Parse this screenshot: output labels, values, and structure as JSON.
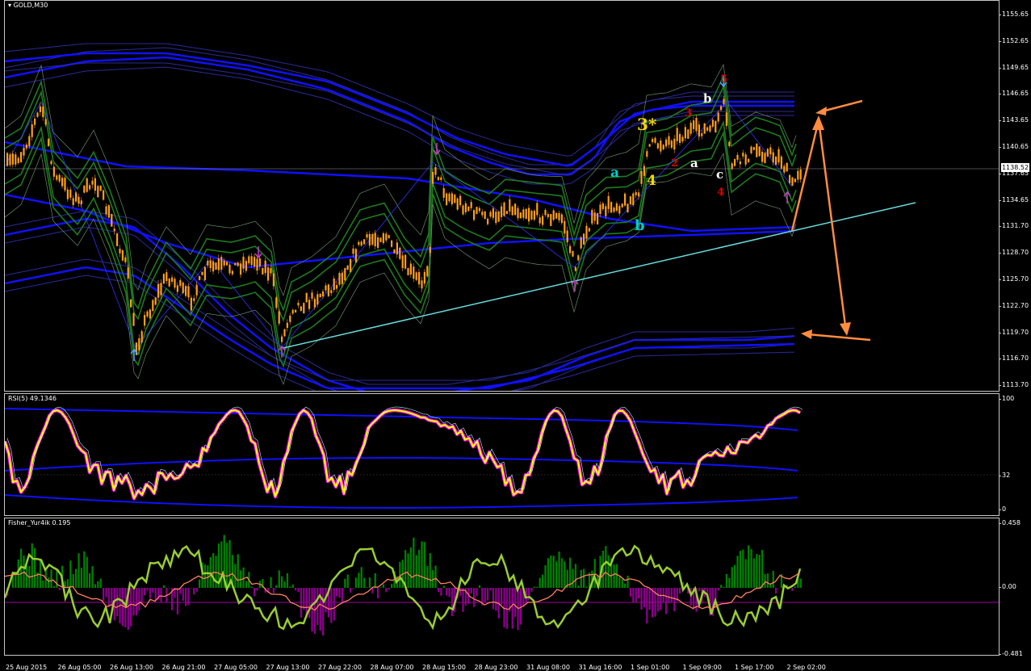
{
  "main": {
    "title": "GOLD,M30",
    "price_current": "1138.52",
    "price_ticks": [
      "1155.65",
      "1152.65",
      "1149.65",
      "1146.65",
      "1143.65",
      "1140.65",
      "1137.65",
      "1134.65",
      "1131.70",
      "1128.70",
      "1125.70",
      "1122.70",
      "1119.70",
      "1116.70",
      "1113.70"
    ],
    "wave_labels": [
      {
        "text": "3*",
        "color": "#ffd700"
      },
      {
        "text": "4",
        "color": "#ffd700"
      },
      {
        "text": "a",
        "color": "#00cccc"
      },
      {
        "text": "b",
        "color": "#00cccc"
      },
      {
        "text": "2",
        "color": "#e00000"
      },
      {
        "text": "3",
        "color": "#e00000"
      },
      {
        "text": "4",
        "color": "#e00000"
      },
      {
        "text": "5",
        "color": "#e00000"
      },
      {
        "text": "a",
        "color": "#ffffff"
      },
      {
        "text": "b",
        "color": "#ffffff"
      },
      {
        "text": "c",
        "color": "#ffffff"
      }
    ]
  },
  "rsi": {
    "title": "RSI(5) 49.1346",
    "ticks": [
      "100",
      "32",
      "0"
    ]
  },
  "fisher": {
    "title": "Fisher_Yur4ik 0.195",
    "ticks": [
      "0.458",
      "0.00",
      "-0.481"
    ]
  },
  "time_axis": [
    "25 Aug 2015",
    "26 Aug 05:00",
    "26 Aug 13:00",
    "26 Aug 21:00",
    "27 Aug 05:00",
    "27 Aug 13:00",
    "27 Aug 22:00",
    "28 Aug 07:00",
    "28 Aug 15:00",
    "28 Aug 23:00",
    "31 Aug 08:00",
    "31 Aug 16:00",
    "1 Sep 01:00",
    "1 Sep 09:00",
    "1 Sep 17:00",
    "2 Sep 02:00"
  ],
  "colors": {
    "candle_bull": "#ff9f1a",
    "candle_bear": "#ff9f1a",
    "band_blue": "#1010ff",
    "band_green": "#1e7a1e",
    "trendline": "#66dddd",
    "arrow_orange": "#ff8c40",
    "rsi_yellow": "#ffff00",
    "rsi_magenta": "#ff00ff",
    "fisher_green": "#9acd32",
    "fisher_hist_pos": "#008000",
    "fisher_hist_neg": "#8b008b"
  }
}
